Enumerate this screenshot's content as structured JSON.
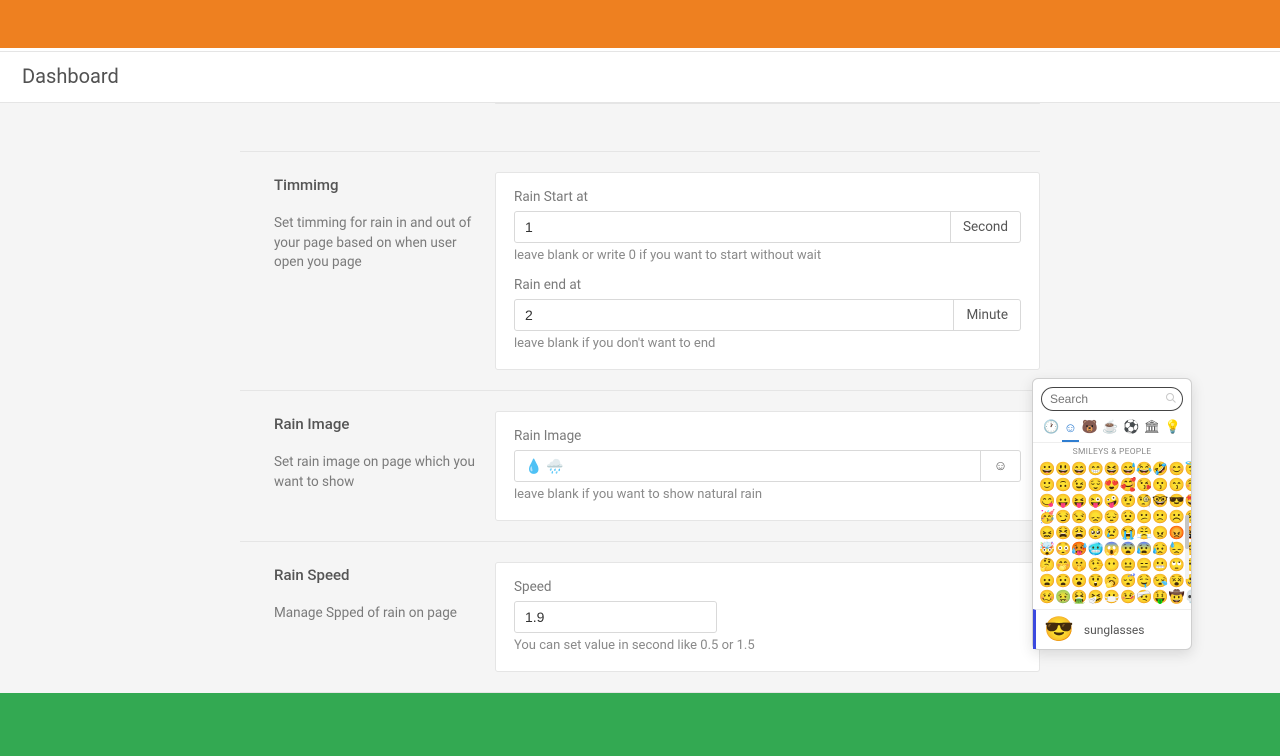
{
  "page_title": "Dashboard",
  "sections": {
    "timing": {
      "title": "Timmimg",
      "desc": "Set timming for rain in and out of your page based on when user open you page",
      "start_label": "Rain Start at",
      "start_value": "1",
      "start_unit": "Second",
      "start_hint": "leave blank or write 0 if you want to start without wait",
      "end_label": "Rain end at",
      "end_value": "2",
      "end_unit": "Minute",
      "end_hint": "leave blank if you don't want to end"
    },
    "image": {
      "title": "Rain Image",
      "desc": "Set rain image on page which you want to show",
      "label": "Rain Image",
      "value": "💧 🌧️",
      "hint": "leave blank if you want to show natural rain"
    },
    "speed": {
      "title": "Rain Speed",
      "desc": "Manage Spped of rain on page",
      "label": "Speed",
      "value": "1.9",
      "hint": "You can set value in second like 0.5 or 1.5"
    }
  },
  "emoji_picker": {
    "search_placeholder": "Search",
    "tabs": [
      "🕐",
      "☺",
      "🐻",
      "☕",
      "⚽",
      "🏛",
      "💡"
    ],
    "active_tab": 1,
    "category_label": "SMILEYS & PEOPLE",
    "grid": [
      "😀",
      "😃",
      "😄",
      "😁",
      "😆",
      "😅",
      "😂",
      "🤣",
      "😊",
      "😇",
      "🙂",
      "🙃",
      "😉",
      "😌",
      "😍",
      "🥰",
      "😘",
      "😗",
      "😙",
      "😚",
      "😋",
      "😛",
      "😝",
      "😜",
      "🤪",
      "🤨",
      "🧐",
      "🤓",
      "😎",
      "🤩",
      "🥳",
      "😏",
      "😒",
      "😞",
      "😔",
      "😟",
      "😕",
      "🙁",
      "☹️",
      "😣",
      "😖",
      "😫",
      "😩",
      "🥺",
      "😢",
      "😭",
      "😤",
      "😠",
      "😡",
      "🤬",
      "🤯",
      "😳",
      "🥵",
      "🥶",
      "😱",
      "😨",
      "😰",
      "😥",
      "😓",
      "🤗",
      "🤔",
      "🤭",
      "🤫",
      "🤥",
      "😶",
      "😐",
      "😑",
      "😬",
      "🙄",
      "😯",
      "😦",
      "😧",
      "😮",
      "😲",
      "🥱",
      "😴",
      "🤤",
      "😪",
      "😵",
      "🤐",
      "🥴",
      "🤢",
      "🤮",
      "🤧",
      "😷",
      "🤒",
      "🤕",
      "🤑",
      "🤠",
      "💀"
    ],
    "preview_emoji": "😎",
    "preview_name": "sunglasses"
  }
}
